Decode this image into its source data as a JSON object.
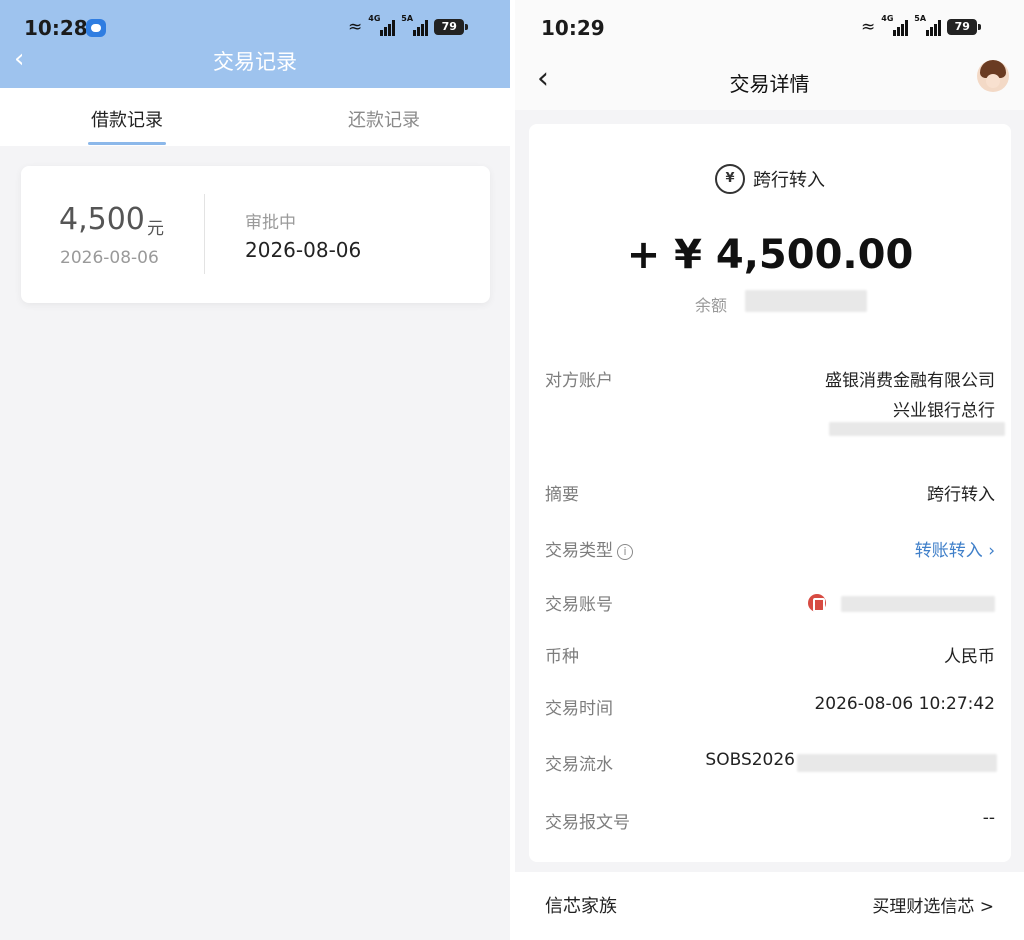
{
  "left": {
    "status": {
      "time": "10:28",
      "battery": "79",
      "sig1": "4G",
      "sig2": "5A"
    },
    "header": {
      "title": "交易记录",
      "back": "‹"
    },
    "tabs": [
      {
        "label": "借款记录"
      },
      {
        "label": "还款记录"
      }
    ],
    "loan": {
      "amount": "4,500",
      "unit": "元",
      "date": "2026-08-06",
      "status": "审批中",
      "status_date": "2026-08-06"
    }
  },
  "right": {
    "status": {
      "time": "10:29",
      "battery": "79",
      "sig1": "4G",
      "sig2": "5A"
    },
    "header": {
      "title": "交易详情",
      "back": "‹"
    },
    "summary": {
      "icon": "¥",
      "type": "跨行转入",
      "amount": "+ ¥ 4,500.00",
      "balance_label": "余额"
    },
    "details": {
      "counterparty_label": "对方账户",
      "counterparty_name": "盛银消费金融有限公司",
      "counterparty_bank": "兴业银行总行",
      "summary_label": "摘要",
      "summary_value": "跨行转入",
      "type_label": "交易类型",
      "type_value": "转账转入 ›",
      "account_label": "交易账号",
      "currency_label": "币种",
      "currency_value": "人民币",
      "time_label": "交易时间",
      "time_value": "2026-08-06 10:27:42",
      "serial_label": "交易流水",
      "serial_value": "SOBS2026",
      "message_label": "交易报文号",
      "message_value": "--"
    },
    "footer": {
      "left": "信芯家族",
      "right": "买理财选信芯 >"
    }
  },
  "colors": {
    "header_blue": "#9ec3ee",
    "link_blue": "#3f7fc9",
    "tab_underline": "#8cb8ea"
  },
  "icons": [
    "back-chevron-icon",
    "wifi-icon",
    "signal-icon",
    "battery-icon",
    "message-icon",
    "yuan-transfer-icon",
    "info-icon",
    "bank-logo-icon",
    "avatar"
  ]
}
